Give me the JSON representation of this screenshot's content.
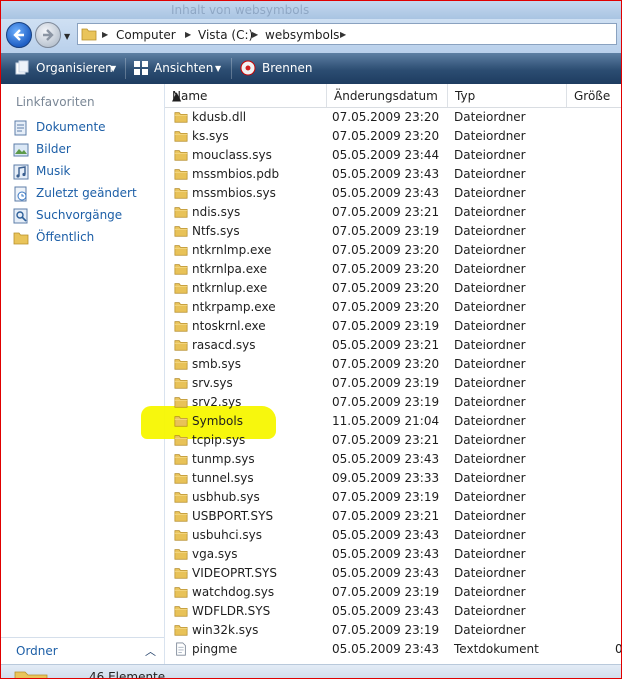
{
  "window": {
    "title": "Inhalt von websymbols"
  },
  "address": {
    "crumbs": [
      "Computer",
      "Vista (C:)",
      "websymbols"
    ]
  },
  "toolbar": {
    "organize": "Organisieren",
    "views": "Ansichten",
    "burn": "Brennen"
  },
  "nav": {
    "title": "Linkfavoriten",
    "items": [
      {
        "label": "Dokumente",
        "icon": "documents-icon"
      },
      {
        "label": "Bilder",
        "icon": "pictures-icon"
      },
      {
        "label": "Musik",
        "icon": "music-icon"
      },
      {
        "label": "Zuletzt geändert",
        "icon": "recent-icon"
      },
      {
        "label": "Suchvorgänge",
        "icon": "search-icon"
      },
      {
        "label": "Öffentlich",
        "icon": "folder-icon"
      }
    ],
    "folders": "Ordner"
  },
  "columns": {
    "name": "Name",
    "date": "Änderungsdatum",
    "type": "Typ",
    "size": "Größe"
  },
  "files": [
    {
      "name": "kdusb.dll",
      "date": "07.05.2009 23:20",
      "type": "Dateiordner",
      "size": ""
    },
    {
      "name": "ks.sys",
      "date": "07.05.2009 23:20",
      "type": "Dateiordner",
      "size": ""
    },
    {
      "name": "mouclass.sys",
      "date": "05.05.2009 23:44",
      "type": "Dateiordner",
      "size": ""
    },
    {
      "name": "mssmbios.pdb",
      "date": "05.05.2009 23:43",
      "type": "Dateiordner",
      "size": ""
    },
    {
      "name": "mssmbios.sys",
      "date": "05.05.2009 23:43",
      "type": "Dateiordner",
      "size": ""
    },
    {
      "name": "ndis.sys",
      "date": "07.05.2009 23:21",
      "type": "Dateiordner",
      "size": ""
    },
    {
      "name": "Ntfs.sys",
      "date": "07.05.2009 23:19",
      "type": "Dateiordner",
      "size": ""
    },
    {
      "name": "ntkrnlmp.exe",
      "date": "07.05.2009 23:20",
      "type": "Dateiordner",
      "size": ""
    },
    {
      "name": "ntkrnlpa.exe",
      "date": "07.05.2009 23:20",
      "type": "Dateiordner",
      "size": ""
    },
    {
      "name": "ntkrnlup.exe",
      "date": "07.05.2009 23:20",
      "type": "Dateiordner",
      "size": ""
    },
    {
      "name": "ntkrpamp.exe",
      "date": "07.05.2009 23:20",
      "type": "Dateiordner",
      "size": ""
    },
    {
      "name": "ntoskrnl.exe",
      "date": "07.05.2009 23:19",
      "type": "Dateiordner",
      "size": ""
    },
    {
      "name": "rasacd.sys",
      "date": "05.05.2009 23:21",
      "type": "Dateiordner",
      "size": ""
    },
    {
      "name": "smb.sys",
      "date": "07.05.2009 23:20",
      "type": "Dateiordner",
      "size": ""
    },
    {
      "name": "srv.sys",
      "date": "07.05.2009 23:19",
      "type": "Dateiordner",
      "size": ""
    },
    {
      "name": "srv2.sys",
      "date": "07.05.2009 23:19",
      "type": "Dateiordner",
      "size": ""
    },
    {
      "name": "Symbols",
      "date": "11.05.2009 21:04",
      "type": "Dateiordner",
      "size": "",
      "highlighted": true
    },
    {
      "name": "tcpip.sys",
      "date": "07.05.2009 23:21",
      "type": "Dateiordner",
      "size": ""
    },
    {
      "name": "tunmp.sys",
      "date": "05.05.2009 23:43",
      "type": "Dateiordner",
      "size": ""
    },
    {
      "name": "tunnel.sys",
      "date": "09.05.2009 23:33",
      "type": "Dateiordner",
      "size": ""
    },
    {
      "name": "usbhub.sys",
      "date": "07.05.2009 23:19",
      "type": "Dateiordner",
      "size": ""
    },
    {
      "name": "USBPORT.SYS",
      "date": "07.05.2009 23:21",
      "type": "Dateiordner",
      "size": ""
    },
    {
      "name": "usbuhci.sys",
      "date": "05.05.2009 23:43",
      "type": "Dateiordner",
      "size": ""
    },
    {
      "name": "vga.sys",
      "date": "05.05.2009 23:43",
      "type": "Dateiordner",
      "size": ""
    },
    {
      "name": "VIDEOPRT.SYS",
      "date": "05.05.2009 23:43",
      "type": "Dateiordner",
      "size": ""
    },
    {
      "name": "watchdog.sys",
      "date": "07.05.2009 23:19",
      "type": "Dateiordner",
      "size": ""
    },
    {
      "name": "WDFLDR.SYS",
      "date": "05.05.2009 23:43",
      "type": "Dateiordner",
      "size": ""
    },
    {
      "name": "win32k.sys",
      "date": "07.05.2009 23:19",
      "type": "Dateiordner",
      "size": ""
    },
    {
      "name": "pingme",
      "date": "05.05.2009 23:43",
      "type": "Textdokument",
      "size": "0",
      "kind": "file"
    }
  ],
  "status": {
    "text": "46 Elemente"
  },
  "colors": {
    "highlight": "#f7f700",
    "link": "#1d5fa7",
    "toolbar": "#2c4d72",
    "frame": "#e00000"
  }
}
